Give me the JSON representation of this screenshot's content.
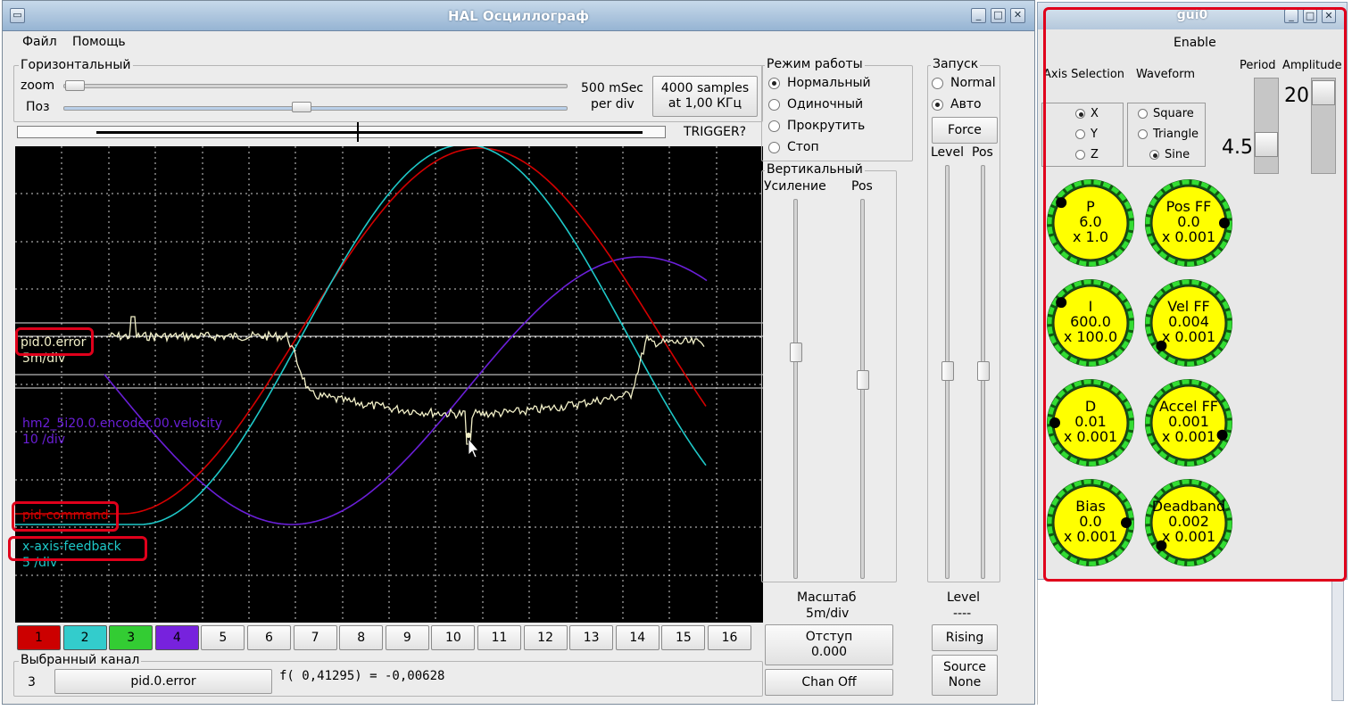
{
  "halscope": {
    "title": "HAL Осциллограф",
    "menu": [
      "Файл",
      "Помощь"
    ],
    "horizontal": {
      "group_label": "Горизонтальный",
      "zoom_label": "zoom",
      "pos_label": "Поз",
      "rate_line1": "500 mSec",
      "rate_line2": "per div",
      "samples_line1": "4000 samples",
      "samples_line2": "at 1,00 КГц",
      "trigger_label": "TRIGGER?"
    },
    "run_mode": {
      "group_label": "Режим работы",
      "options": [
        "Нормальный",
        "Одиночный",
        "Прокрутить",
        "Стоп"
      ],
      "selected": 0
    },
    "trigger": {
      "group_label": "Запуск",
      "options": [
        "Normal",
        "Авто"
      ],
      "selected": 1,
      "force_label": "Force",
      "level_label": "Level",
      "pos_label": "Pos",
      "level_caption": "Level",
      "level_value": "----",
      "edge_label": "Rising",
      "source_line1": "Source",
      "source_line2": "None"
    },
    "vertical": {
      "group_label": "Вертикальный",
      "gain_label": "Усиление",
      "pos_label": "Pos",
      "scale_label": "Масштаб",
      "scale_value": "5m/div",
      "offset_label": "Отступ",
      "offset_value": "0.000",
      "chan_off_label": "Chan Off"
    },
    "traces": [
      {
        "name": "pid.0.error",
        "scale": "5m/div",
        "color": "#f2f0c8"
      },
      {
        "name": "hm2_5i20.0.encoder.00.velocity",
        "scale": "10 /div",
        "color": "#6a1fd8"
      },
      {
        "name": "pid-command",
        "scale": "",
        "color": "#d40000"
      },
      {
        "name": "x-axis-feedback",
        "scale": "5 /div",
        "color": "#1ec8c8"
      }
    ],
    "channels": [
      "1",
      "2",
      "3",
      "4",
      "5",
      "6",
      "7",
      "8",
      "9",
      "10",
      "11",
      "12",
      "13",
      "14",
      "15",
      "16"
    ],
    "channel_colors": [
      "#cc0000",
      "#33cccc",
      "#33cc33",
      "#7722dd"
    ],
    "selected_channel": {
      "group_label": "Выбранный канал",
      "number": "3",
      "name": "pid.0.error",
      "readout": "f( 0,41295) = -0,00628"
    }
  },
  "gui0": {
    "title": "gui0",
    "enable_label": "Enable",
    "axis_selection_label": "Axis Selection",
    "waveform_label": "Waveform",
    "period_label": "Period",
    "amplitude_label": "Amplitude",
    "axes": [
      "X",
      "Y",
      "Z"
    ],
    "axis_selected": 0,
    "waveforms": [
      "Square",
      "Triangle",
      "Sine"
    ],
    "waveform_selected": 2,
    "period_value": "4.5",
    "amplitude_value": "20",
    "knobs": [
      {
        "name": "P",
        "value": "6.0",
        "scale": "x 1.0",
        "marker_angle": 215
      },
      {
        "name": "Pos FF",
        "value": "0.0",
        "scale": "x 0.001",
        "marker_angle": 0
      },
      {
        "name": "I",
        "value": "600.0",
        "scale": "x 100.0",
        "marker_angle": 215
      },
      {
        "name": "Vel FF",
        "value": "0.004",
        "scale": "x 0.001",
        "marker_angle": 140
      },
      {
        "name": "D",
        "value": "0.01",
        "scale": "x 0.001",
        "marker_angle": 180
      },
      {
        "name": "Accel FF",
        "value": "0.001",
        "scale": "x 0.001",
        "marker_angle": 20
      },
      {
        "name": "Bias",
        "value": "0.0",
        "scale": "x 0.001",
        "marker_angle": 0
      },
      {
        "name": "Deadband",
        "value": "0.002",
        "scale": "x 0.001",
        "marker_angle": 140
      }
    ]
  }
}
